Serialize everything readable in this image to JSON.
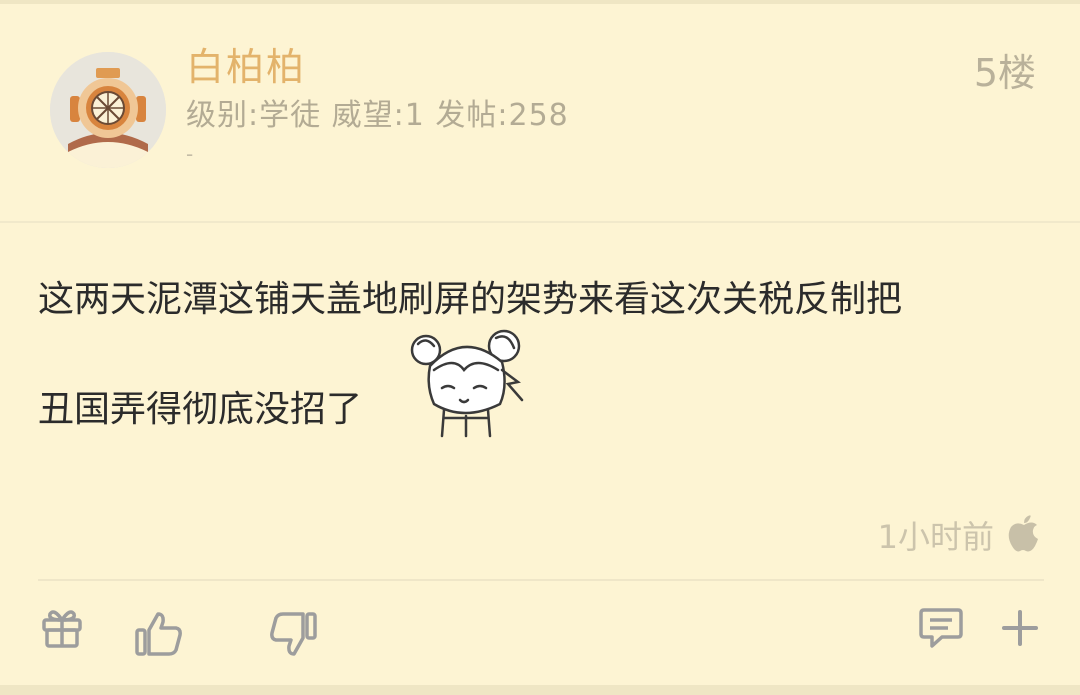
{
  "post": {
    "username": "白柏柏",
    "user_info": "级别:学徒  威望:1  发帖:258",
    "signature": "-",
    "floor": "5楼",
    "content_line1": "这两天泥潭这铺天盖地刷屏的架势来看这次关税反制把",
    "content_line2": "丑国弄得彻底没招了",
    "time": "1小时前"
  },
  "icons": {
    "avatar": "diving-helmet-avatar",
    "sticker": "anime-girl-sticker",
    "device": "apple-icon",
    "gift": "gift-icon",
    "like": "thumbs-up-icon",
    "dislike": "thumbs-down-icon",
    "comment": "comment-icon",
    "more": "plus-icon"
  },
  "colors": {
    "background": "#fdf4d3",
    "username": "#e3b36b",
    "text": "#2b2b2b",
    "muted": "#b3ab94",
    "icon": "#9d9d9d"
  }
}
